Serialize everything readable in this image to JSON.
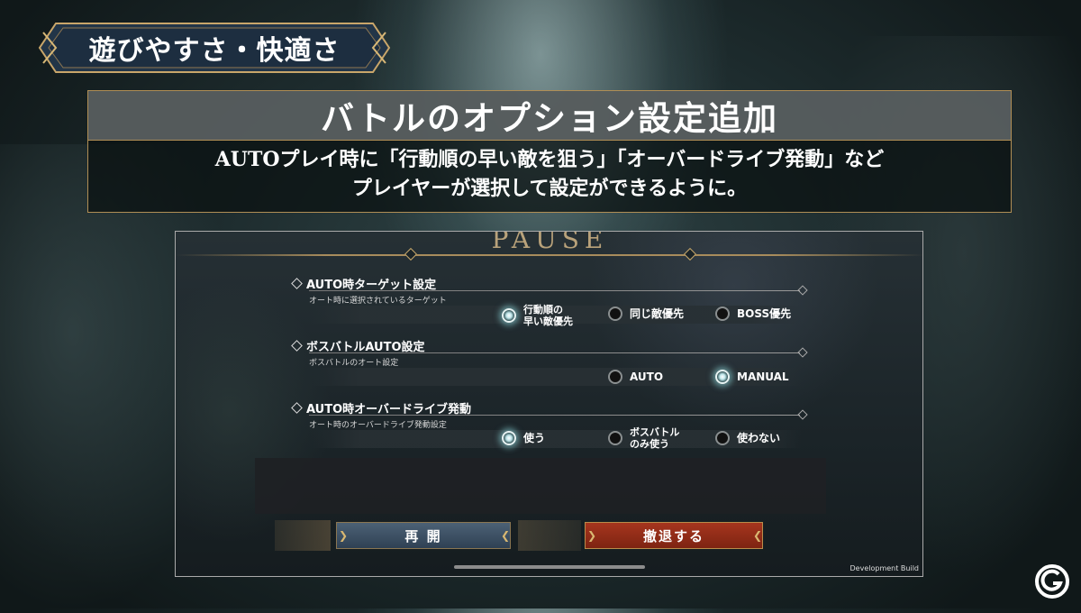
{
  "section_tag": "遊びやすさ・快適さ",
  "headline": {
    "title": "バトルのオプション設定追加",
    "desc_line1": "AUTOプレイ時に「行動順の早い敵を狙う」「オーバードライブ発動」など",
    "desc_line2": "プレイヤーが選択して設定ができるように。"
  },
  "game": {
    "pause_title": "PAUSE",
    "groups": [
      {
        "title": "AUTO時ターゲット設定",
        "subtitle": "オート時に選択されているターゲット",
        "options": [
          {
            "label": "行動順の\n早い敵優先",
            "selected": true
          },
          {
            "label": "同じ敵優先",
            "selected": false
          },
          {
            "label": "BOSS優先",
            "selected": false
          }
        ]
      },
      {
        "title": "ボスバトルAUTO設定",
        "subtitle": "ボスバトルのオート設定",
        "options": [
          {
            "label": "AUTO",
            "selected": false
          },
          {
            "label": "MANUAL",
            "selected": true
          }
        ]
      },
      {
        "title": "AUTO時オーバードライブ発動",
        "subtitle": "オート時のオーバードライブ発動設定",
        "options": [
          {
            "label": "使う",
            "selected": true
          },
          {
            "label": "ボスバトル\nのみ使う",
            "selected": false
          },
          {
            "label": "使わない",
            "selected": false
          }
        ]
      }
    ],
    "buttons": {
      "resume": "再 開",
      "retreat": "撤退する"
    },
    "dev_build": "Development Build"
  },
  "colors": {
    "accent_gold": "#b08e55",
    "resume_blue": "#3d5165",
    "retreat_red": "#952e18",
    "radio_glow": "#bfe6ea"
  }
}
